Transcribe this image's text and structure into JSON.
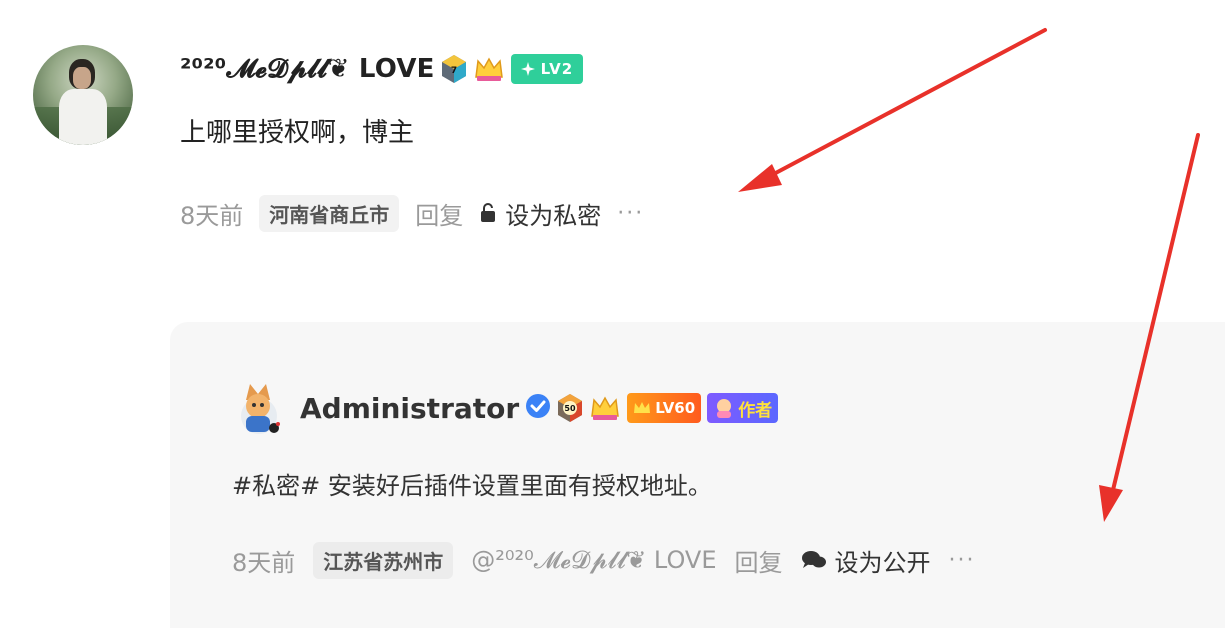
{
  "comment": {
    "username": "²⁰²⁰𝓜𝓮𝓓𝓹𝓵𝓵❦ LOVE",
    "badge_level_number": "7",
    "level_badge": "LV2",
    "text": "上哪里授权啊，博主",
    "time": "8天前",
    "location": "河南省商丘市",
    "reply_label": "回复",
    "private_label": "设为私密",
    "more_label": "···"
  },
  "reply": {
    "username": "Administrator",
    "badge_level_number": "50",
    "level_badge": "LV60",
    "author_badge": "作者",
    "text": "#私密# 安装好后插件设置里面有授权地址。",
    "time": "8天前",
    "location": "江苏省苏州市",
    "mention": "@²⁰²⁰𝓜𝓮𝓓𝓹𝓵𝓵❦ LOVE",
    "reply_label": "回复",
    "public_label": "设为公开",
    "more_label": "···"
  },
  "colors": {
    "lv_green": "#2fcf9a",
    "arrow_red": "#e8312a",
    "verified_blue": "#3b82f6"
  },
  "icons": {
    "lock": "lock-icon",
    "chat": "chat-bubble-icon",
    "verified": "verified-check-icon",
    "sparkle": "sparkle-icon",
    "crown": "crown-icon"
  }
}
